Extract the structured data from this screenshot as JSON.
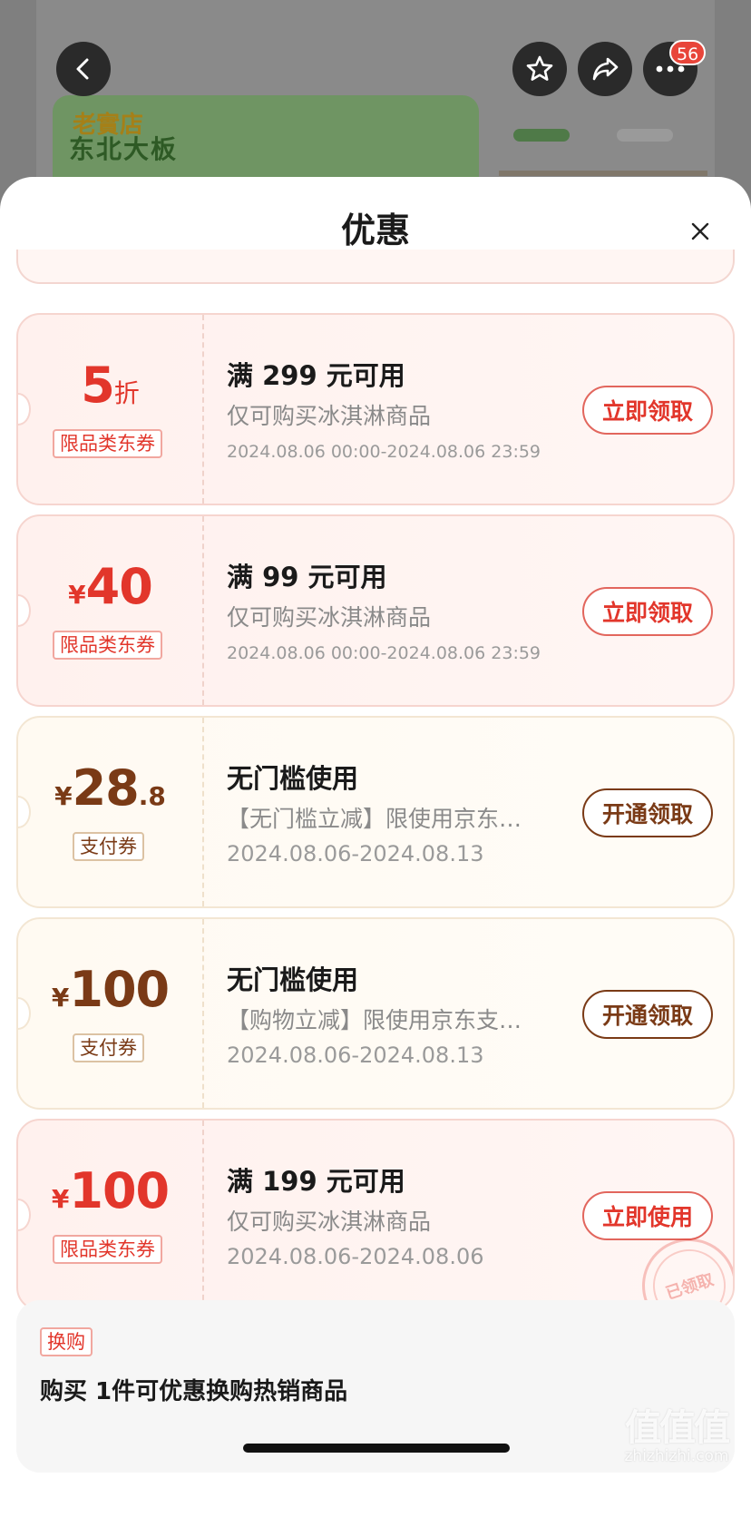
{
  "background_page": {
    "banner_logo": "老實店",
    "banner_title": "东北大板",
    "message_badge": "56"
  },
  "sheet": {
    "title": "优惠"
  },
  "coupons": [
    {
      "theme": "red",
      "currency": "",
      "amount": "5",
      "amount_decimal": "",
      "amount_unit": "折",
      "tag": "限品类东券",
      "title": "满 299 元可用",
      "description": "仅可购买冰淇淋商品",
      "date": "2024.08.06 00:00-2024.08.06 23:59",
      "button": "立即领取",
      "claimed_stamp": ""
    },
    {
      "theme": "red",
      "currency": "¥",
      "amount": "40",
      "amount_decimal": "",
      "amount_unit": "",
      "tag": "限品类东券",
      "title": "满 99 元可用",
      "description": "仅可购买冰淇淋商品",
      "date": "2024.08.06 00:00-2024.08.06 23:59",
      "button": "立即领取",
      "claimed_stamp": ""
    },
    {
      "theme": "gold",
      "currency": "¥",
      "amount": "28",
      "amount_decimal": ".8",
      "amount_unit": "",
      "tag": "支付券",
      "title": "无门槛使用",
      "description": "【无门槛立减】限使用京东…",
      "date": "2024.08.06-2024.08.13",
      "button": "开通领取",
      "claimed_stamp": ""
    },
    {
      "theme": "gold",
      "currency": "¥",
      "amount": "100",
      "amount_decimal": "",
      "amount_unit": "",
      "tag": "支付券",
      "title": "无门槛使用",
      "description": "【购物立减】限使用京东支…",
      "date": "2024.08.06-2024.08.13",
      "button": "开通领取",
      "claimed_stamp": ""
    },
    {
      "theme": "red",
      "currency": "¥",
      "amount": "100",
      "amount_decimal": "",
      "amount_unit": "",
      "tag": "限品类东券",
      "title": "满 199 元可用",
      "description": "仅可购买冰淇淋商品",
      "date": "2024.08.06-2024.08.06",
      "button": "立即使用",
      "claimed_stamp": "已领取"
    }
  ],
  "trade_in": {
    "tag": "换购",
    "text": "购买 1件可优惠换购热销商品"
  },
  "watermark": {
    "big": "值值值",
    "small": "zhizhizhi.com"
  },
  "icons": {
    "back": "chevron-left-icon",
    "favorite": "star-icon",
    "share": "share-arrow-icon",
    "more": "more-dots-icon",
    "close": "close-icon"
  },
  "colors": {
    "accent_red": "#e2362b",
    "accent_brown": "#7a3a16",
    "badge_red": "#e8453a"
  }
}
